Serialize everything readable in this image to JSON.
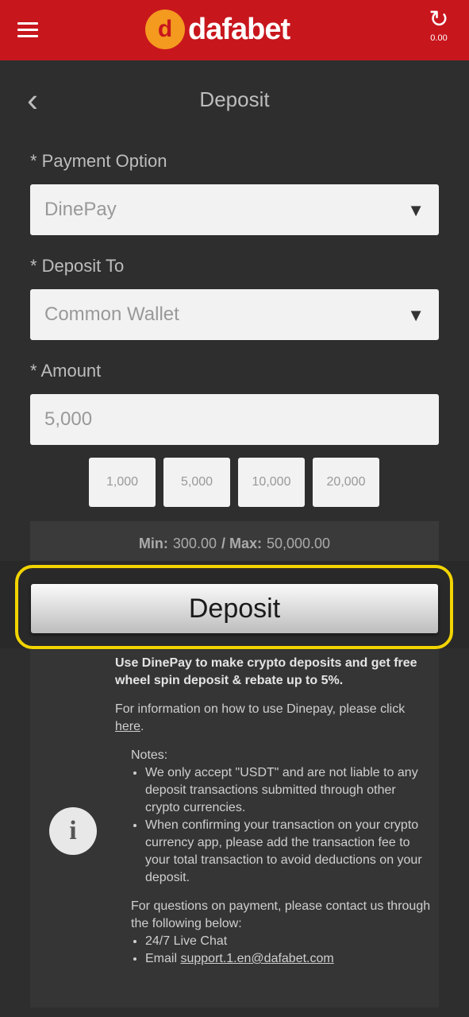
{
  "topbar": {
    "menu_icon": "hamburger-icon",
    "logo_mark": "d",
    "logo_text": "dafabet",
    "refresh_icon": "refresh-icon",
    "refresh_label": "0.00"
  },
  "header": {
    "back_icon": "chevron-left-icon",
    "title": "Deposit"
  },
  "form": {
    "payment_option_label": "* Payment Option",
    "payment_option_value": "DinePay",
    "deposit_to_label": "* Deposit To",
    "deposit_to_value": "Common Wallet",
    "amount_label": "* Amount",
    "amount_value": "5,000",
    "quick_amounts": [
      "1,000",
      "5,000",
      "10,000",
      "20,000"
    ],
    "min_label": "Min:",
    "min_value": "300.00",
    "max_label": "/ Max:",
    "max_value": "50,000.00",
    "deposit_button": "Deposit"
  },
  "info": {
    "icon": "info-icon",
    "p1": "Use DinePay to make crypto deposits and get free wheel spin deposit & rebate up to 5%.",
    "p2_before": "For information on how to use Dinepay, please click",
    "p2_link": "here",
    "notes_title": "Notes:",
    "note1": "We only accept \"USDT\" and are not liable to any deposit transactions submitted through other crypto currencies.",
    "note2": "When confirming your transaction on your crypto currency app, please add the transaction fee to your total transaction to avoid deductions on your deposit.",
    "contact": "For questions on payment, please contact us through the following below:",
    "contact1": "24/7 Live Chat",
    "contact2_prefix": "Email",
    "contact2_link": "support.1.en@dafabet.com"
  },
  "colors": {
    "topbar": "#c8161d",
    "highlight": "#f1d400",
    "background": "#2e2e2e"
  }
}
